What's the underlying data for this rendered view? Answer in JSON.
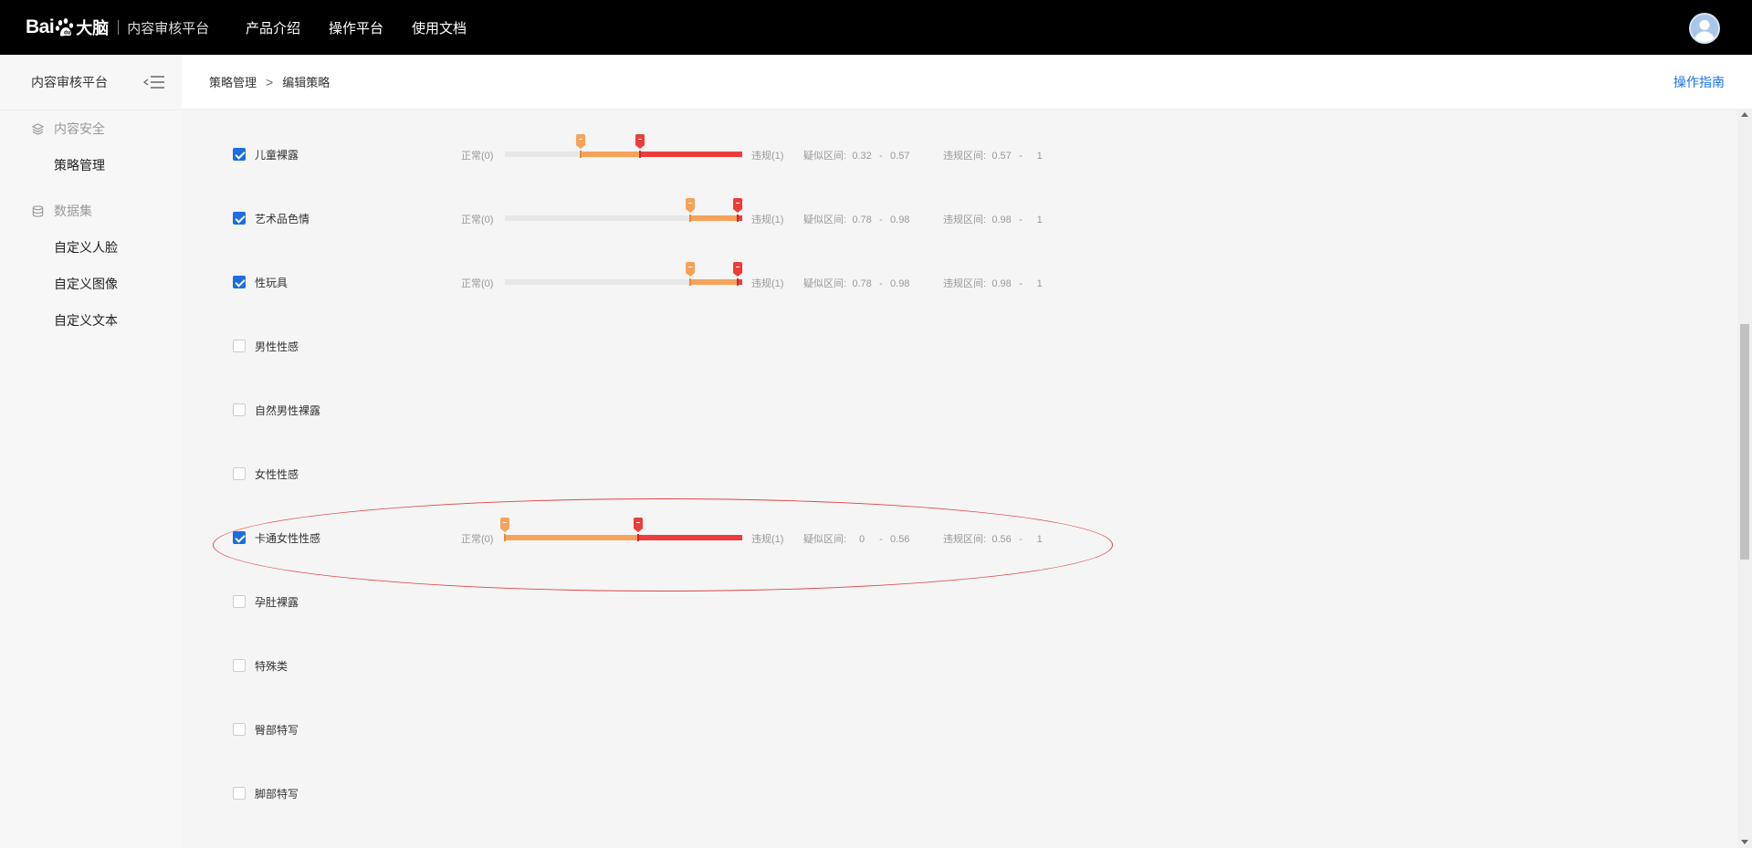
{
  "topbar": {
    "logo_baidu": "Bai",
    "logo_dana": "大脑",
    "logo_platform": "内容审核平台",
    "nav": [
      "产品介绍",
      "操作平台",
      "使用文档"
    ]
  },
  "sidebar": {
    "title": "内容审核平台",
    "groups": [
      {
        "label": "内容安全",
        "icon": "layers-icon",
        "items": [
          "策略管理"
        ]
      },
      {
        "label": "数据集",
        "icon": "database-icon",
        "items": [
          "自定义人脸",
          "自定义图像",
          "自定义文本"
        ]
      }
    ]
  },
  "breadcrumb": {
    "parent": "策略管理",
    "sep": ">",
    "current": "编辑策略"
  },
  "guide_label": "操作指南",
  "slider_labels": {
    "normal": "正常(0)",
    "violate": "违规(1)",
    "suspect_prefix": "疑似区间:",
    "violate_prefix": "违规区间:",
    "dash": "-"
  },
  "rows": [
    {
      "label": "儿童裸露",
      "checked": true,
      "suspect": [
        0.32,
        0.57
      ],
      "violate": [
        0.57,
        1
      ]
    },
    {
      "label": "艺术品色情",
      "checked": true,
      "suspect": [
        0.78,
        0.98
      ],
      "violate": [
        0.98,
        1
      ]
    },
    {
      "label": "性玩具",
      "checked": true,
      "suspect": [
        0.78,
        0.98
      ],
      "violate": [
        0.98,
        1
      ]
    },
    {
      "label": "男性性感",
      "checked": false
    },
    {
      "label": "自然男性裸露",
      "checked": false
    },
    {
      "label": "女性性感",
      "checked": false
    },
    {
      "label": "卡通女性性感",
      "checked": true,
      "suspect": [
        0,
        0.56
      ],
      "violate": [
        0.56,
        1
      ],
      "highlighted": true
    },
    {
      "label": "孕肚裸露",
      "checked": false
    },
    {
      "label": "特殊类",
      "checked": false
    },
    {
      "label": "臀部特写",
      "checked": false
    },
    {
      "label": "脚部特写",
      "checked": false
    }
  ],
  "colors": {
    "suspect": "#f7a25a",
    "violate": "#ee3b3b",
    "checkbox": "#1c6ee0",
    "annotation": "#e04545",
    "link": "#1a73e8"
  }
}
